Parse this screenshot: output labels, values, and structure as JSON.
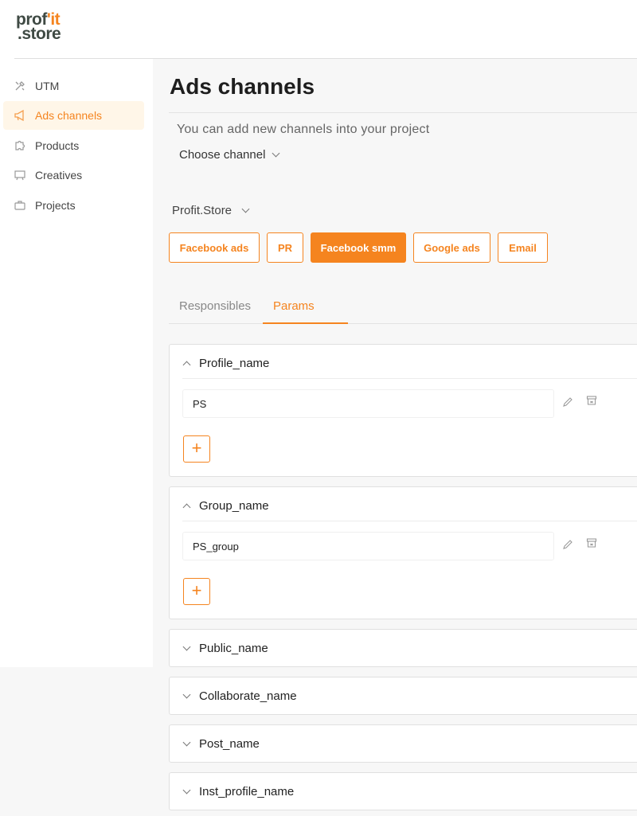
{
  "logo": {
    "line1_a": "prof",
    "line1_b": "'it",
    "line2": ".store"
  },
  "sidebar": {
    "items": [
      {
        "label": "UTM",
        "icon": "tools-icon"
      },
      {
        "label": "Ads channels",
        "icon": "megaphone-icon"
      },
      {
        "label": "Products",
        "icon": "puzzle-icon"
      },
      {
        "label": "Creatives",
        "icon": "easel-icon"
      },
      {
        "label": "Projects",
        "icon": "briefcase-icon"
      }
    ],
    "active": "Ads channels"
  },
  "main": {
    "title": "Ads channels",
    "hint": "You can add new channels into your project",
    "choose_channel": "Choose channel",
    "project": "Profit.Store",
    "channels": [
      "Facebook ads",
      "PR",
      "Facebook smm",
      "Google ads",
      "Email"
    ],
    "active_channel": "Facebook smm",
    "tabs": [
      "Responsibles",
      "Params"
    ],
    "active_tab": "Params",
    "params": [
      {
        "name": "Profile_name",
        "expanded": true,
        "values": [
          "PS"
        ]
      },
      {
        "name": "Group_name",
        "expanded": true,
        "values": [
          "PS_group"
        ]
      },
      {
        "name": "Public_name",
        "expanded": false
      },
      {
        "name": "Collaborate_name",
        "expanded": false
      },
      {
        "name": "Post_name",
        "expanded": false
      },
      {
        "name": "Inst_profile_name",
        "expanded": false
      }
    ],
    "add_label": "+"
  },
  "colors": {
    "accent": "#f5841f",
    "background": "#f7f7f7"
  }
}
